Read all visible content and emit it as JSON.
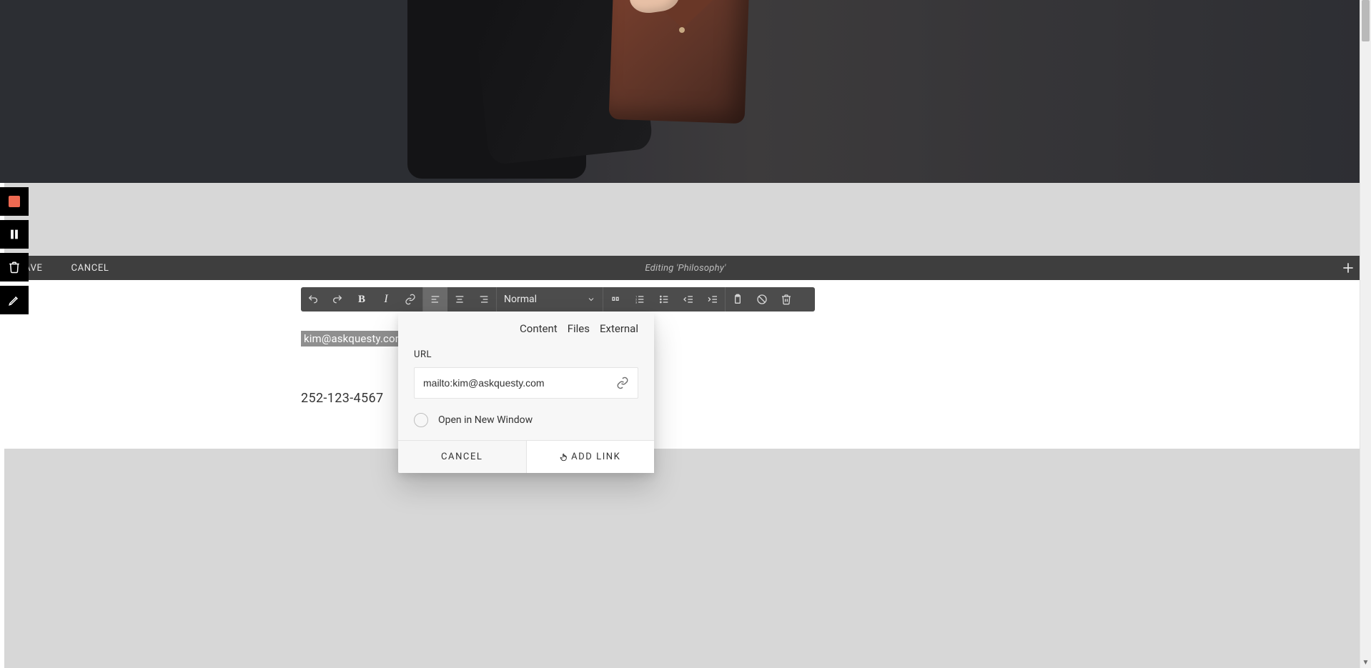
{
  "editor": {
    "save_label": "AVE",
    "cancel_label": "CANCEL",
    "editing_prefix": "Editing ",
    "editing_name": "'Philosophy'"
  },
  "toolbar": {
    "style_dropdown": "Normal"
  },
  "content": {
    "email_highlighted": "kim@askquesty.com",
    "phone": "252-123-4567"
  },
  "link_popover": {
    "tabs": [
      "Content",
      "Files",
      "External"
    ],
    "url_label": "URL",
    "url_value": "mailto:kim@askquesty.com",
    "new_window_label": "Open in New Window",
    "cancel_label": "CANCEL",
    "add_label": "ADD LINK"
  }
}
